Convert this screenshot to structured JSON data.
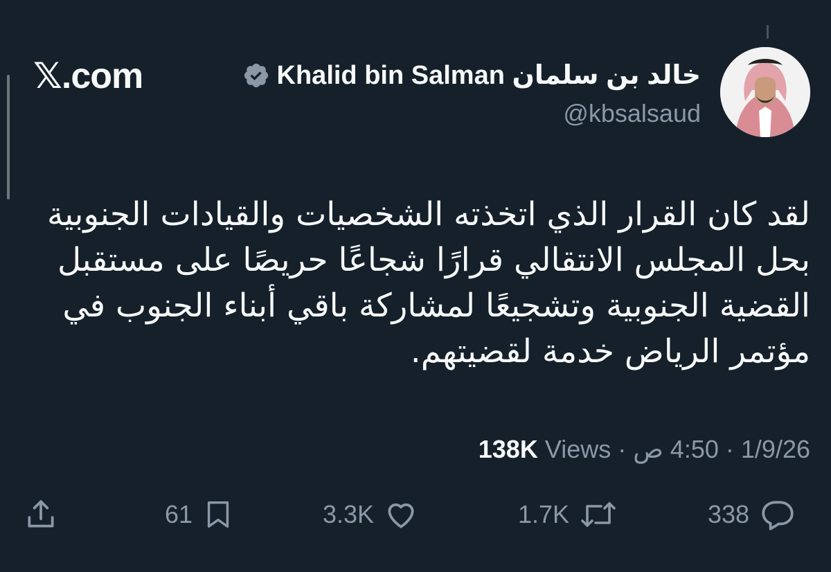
{
  "brand": {
    "label": "𝕏.com"
  },
  "user": {
    "display_name": "Khalid bin Salman خالد بن سلمان",
    "handle": "@kbsalsaud"
  },
  "tweet": {
    "text": "لقد كان القرار الذي اتخذته الشخصيات والقيادات الجنوبية بحل المجلس الانتقالي قرارًا شجاعًا حريصًا على مستقبل القضية الجنوبية وتشجيعًا لمشاركة باقي أبناء الجنوب في مؤتمر الرياض خدمة لقضيتهم."
  },
  "meta": {
    "date": "1/9/26",
    "separator": "·",
    "time": "4:50 ص",
    "views_count": "138K",
    "views_label": "Views"
  },
  "actions": {
    "replies": "338",
    "reposts": "1.7K",
    "likes": "3.3K",
    "bookmarks": "61"
  },
  "icons": {
    "verified": "verified-badge-icon",
    "reply": "reply-icon",
    "repost": "repost-icon",
    "like": "heart-icon",
    "bookmark": "bookmark-icon",
    "share": "share-icon"
  },
  "colors": {
    "background": "#15202b",
    "text": "#f7f9f9",
    "muted": "#8b98a5",
    "verified": "#8b98a5"
  }
}
